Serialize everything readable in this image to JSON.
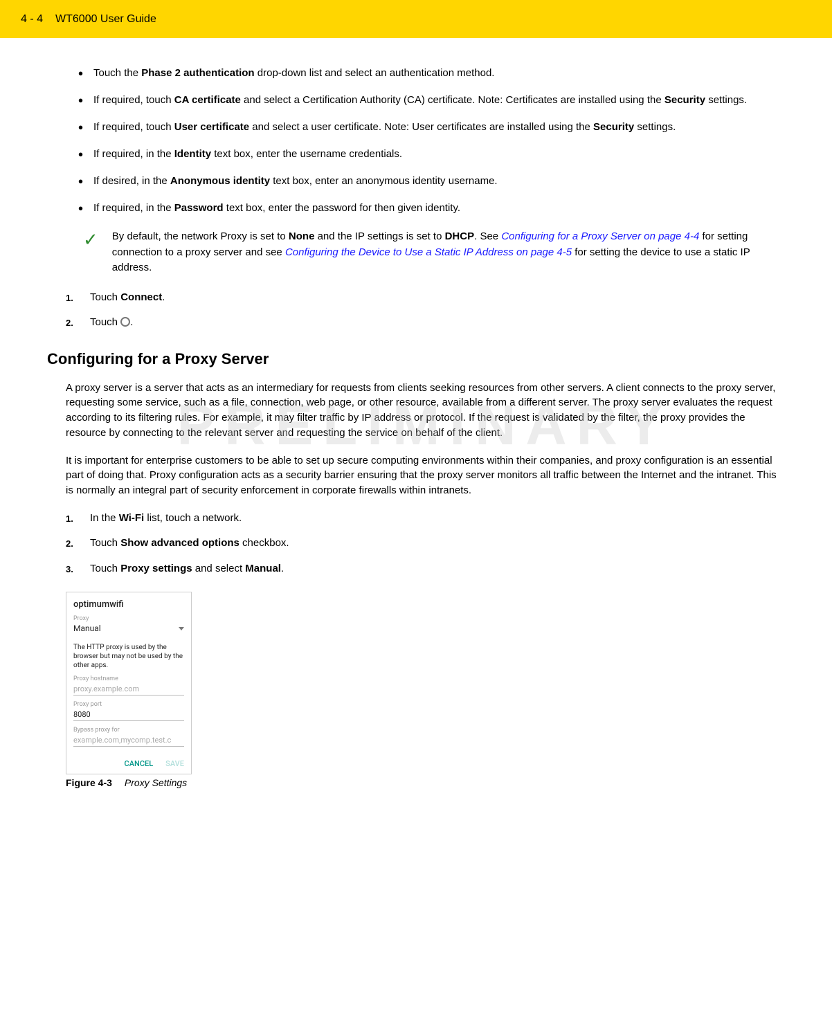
{
  "header": {
    "page_num": "4 - 4",
    "title": "WT6000 User Guide"
  },
  "bullets": [
    {
      "pre": "Touch the ",
      "b1": "Phase 2 authentication",
      "post": " drop-down list and select an authentication method."
    },
    {
      "pre": "If required, touch ",
      "b1": "CA certificate",
      "mid": " and select a Certification Authority (CA) certificate. Note: Certificates are installed using the ",
      "b2": "Security",
      "post": " settings."
    },
    {
      "pre": "If required, touch ",
      "b1": "User certificate",
      "mid": " and select a user certificate. Note: User certificates are installed using the ",
      "b2": "Security",
      "post": " settings."
    },
    {
      "pre": "If required, in the ",
      "b1": "Identity",
      "post": " text box, enter the username credentials."
    },
    {
      "pre": "If desired, in the ",
      "b1": "Anonymous identity",
      "post": " text box, enter an anonymous identity username."
    },
    {
      "pre": "If required, in the ",
      "b1": "Password",
      "post": " text box, enter the password for then given identity."
    }
  ],
  "note": {
    "t1": "By default, the network Proxy is set to ",
    "b1": "None",
    "t2": " and the IP settings is set to ",
    "b2": "DHCP",
    "t3": ". See ",
    "link1": "Configuring for a Proxy Server on page 4-4",
    "t4": " for setting connection to a proxy server and see ",
    "link2": "Configuring the Device to Use a Static IP Address on page 4-5",
    "t5": " for setting the device to use a static IP address."
  },
  "steps1": [
    {
      "num": "1.",
      "pre": "Touch ",
      "b1": "Connect",
      "post": "."
    },
    {
      "num": "2.",
      "pre": "Touch ",
      "icon": true,
      "post": "."
    }
  ],
  "section_heading": "Configuring for a Proxy Server",
  "watermark": "PRELIMINARY",
  "para1": "A proxy server is a server that acts as an intermediary for requests from clients seeking resources from other servers. A client connects to the proxy server, requesting some service, such as a file, connection, web page, or other resource, available from a different server. The proxy server evaluates the request according to its filtering rules. For example, it may filter traffic by IP address or protocol. If the request is validated by the filter, the proxy provides the resource by connecting to the relevant server and requesting the service on behalf of the client.",
  "para2": "It is important for enterprise customers to be able to set up secure computing environments within their companies, and proxy configuration is an essential part of doing that. Proxy configuration acts as a security barrier ensuring that the proxy server monitors all traffic between the Internet and the intranet. This is normally an integral part of security enforcement in corporate firewalls within intranets.",
  "steps2": [
    {
      "num": "1.",
      "pre": "In the ",
      "b1": "Wi-Fi",
      "post": " list, touch a network."
    },
    {
      "num": "2.",
      "pre": "Touch ",
      "b1": "Show advanced options",
      "post": " checkbox."
    },
    {
      "num": "3.",
      "pre": "Touch ",
      "b1": "Proxy settings",
      "mid": " and select ",
      "b2": "Manual",
      "post": "."
    }
  ],
  "dialog": {
    "ssid": "optimumwifi",
    "proxy_label": "Proxy",
    "proxy_value": "Manual",
    "info": "The HTTP proxy is used by the browser but may not be used by the other apps.",
    "hostname_label": "Proxy hostname",
    "hostname_value": "proxy.example.com",
    "port_label": "Proxy port",
    "port_value": "8080",
    "bypass_label": "Bypass proxy for",
    "bypass_value": "example.com,mycomp.test.c",
    "cancel": "CANCEL",
    "save": "SAVE"
  },
  "figure": {
    "label": "Figure 4-3",
    "title": "Proxy Settings"
  }
}
